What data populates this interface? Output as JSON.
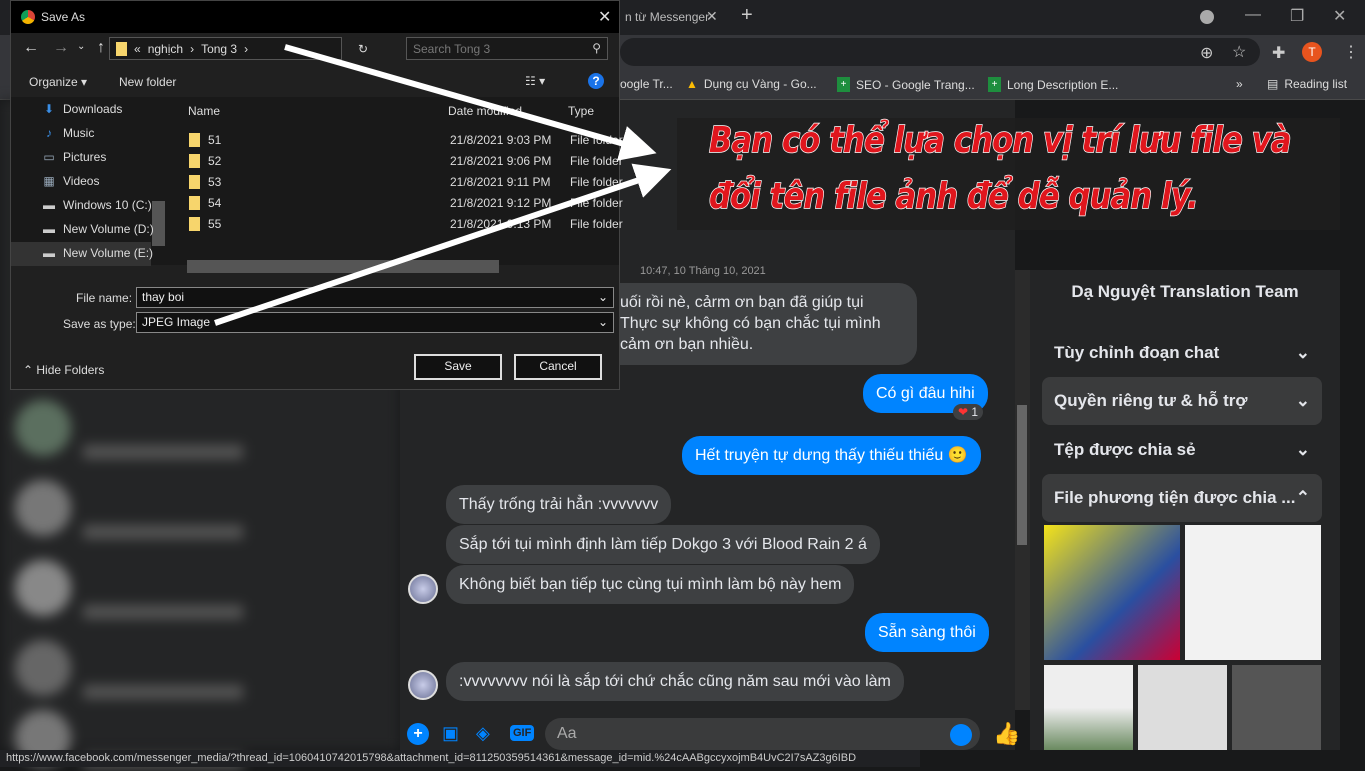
{
  "browser": {
    "tab_title": "n từ Messenger",
    "bookmarks": [
      {
        "label": "oogle Tr...",
        "icon": "globe-icon"
      },
      {
        "label": "Dụng cụ Vàng - Go...",
        "icon": "drive-icon"
      },
      {
        "label": "SEO - Google Trang...",
        "icon": "sheets-icon"
      },
      {
        "label": "Long Description E...",
        "icon": "sheets-icon"
      }
    ],
    "more_bookmarks": "»",
    "reading_list": "Reading list",
    "profile_initial": "T",
    "status_url": "https://www.facebook.com/messenger_media/?thread_id=1060410742015798&attachment_id=811250359514361&message_id=mid.%24cAABgccyxojmB4UvC2I7sAZ3g6IBD"
  },
  "dialog": {
    "title": "Save As",
    "breadcrumb": [
      "«",
      "nghịch",
      "Tong 3"
    ],
    "search_placeholder": "Search Tong 3",
    "organize": "Organize",
    "new_folder": "New folder",
    "nav_items": [
      {
        "label": "Downloads",
        "icon": "download-icon"
      },
      {
        "label": "Music",
        "icon": "music-icon"
      },
      {
        "label": "Pictures",
        "icon": "pictures-icon"
      },
      {
        "label": "Videos",
        "icon": "videos-icon"
      },
      {
        "label": "Windows 10 (C:)",
        "icon": "drive-icon"
      },
      {
        "label": "New Volume (D:)",
        "icon": "drive-icon"
      },
      {
        "label": "New Volume (E:)",
        "icon": "drive-icon"
      }
    ],
    "columns": [
      "Name",
      "Date modified",
      "Type"
    ],
    "files": [
      {
        "name": "51",
        "date": "21/8/2021 9:03 PM",
        "type": "File folder"
      },
      {
        "name": "52",
        "date": "21/8/2021 9:06 PM",
        "type": "File folder"
      },
      {
        "name": "53",
        "date": "21/8/2021 9:11 PM",
        "type": "File folder"
      },
      {
        "name": "54",
        "date": "21/8/2021 9:12 PM",
        "type": "File folder"
      },
      {
        "name": "55",
        "date": "21/8/2021 9:13 PM",
        "type": "File folder"
      }
    ],
    "file_name_label": "File name:",
    "file_name_value": "thay boi",
    "save_type_label": "Save as type:",
    "save_type_value": "JPEG Image",
    "hide_folders": "Hide Folders",
    "save": "Save",
    "cancel": "Cancel"
  },
  "annotation": {
    "line1": "Bạn có thể lựa chọn vị trí lưu file và",
    "line2": "đổi tên file ảnh để dễ quản lý."
  },
  "chat": {
    "timestamp": "10:47, 10 Tháng 10, 2021",
    "messages": [
      {
        "side": "in",
        "text": "uối rồi nè, cảrm ơn bạn đã giúp tụi\nThực sự không có bạn chắc tụi mình\ncảm ơn bạn nhiều."
      },
      {
        "side": "out",
        "text": "Có gì đâu hihi",
        "reaction": "1"
      },
      {
        "side": "out",
        "text": "Hết truyện tự dưng thấy thiếu thiếu 🙂"
      },
      {
        "side": "in",
        "text": "Thấy trống trải hẳn :vvvvvvv"
      },
      {
        "side": "in",
        "text": "Sắp tới tụi mình định làm tiếp Dokgo 3 với Blood Rain 2 á"
      },
      {
        "side": "in",
        "text": "Không biết bạn tiếp tục cùng tụi mình làm bộ này hem"
      },
      {
        "side": "out",
        "text": "Sẵn sàng thôi"
      },
      {
        "side": "in",
        "text": ":vvvvvvvv nói là sắp tới chứ chắc cũng năm sau mới vào làm"
      }
    ],
    "composer_placeholder": "Aa",
    "gif_label": "GIF"
  },
  "panel": {
    "name": "Dạ Nguyệt Translation Team",
    "sections": [
      "Tùy chỉnh đoạn chat",
      "Quyền riêng tư & hỗ trợ",
      "Tệp được chia sẻ",
      "File phương tiện được chia ..."
    ]
  },
  "colors": {
    "accent": "#0084ff",
    "annotation_red": "#e0161d"
  }
}
